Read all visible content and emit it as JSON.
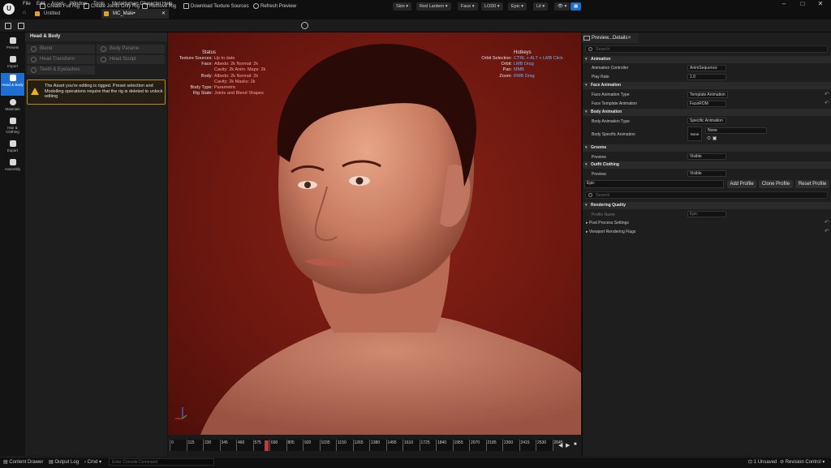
{
  "menu": [
    "File",
    "Edit",
    "Asset",
    "Window",
    "Tools",
    "MetaHuman Character",
    "Help"
  ],
  "tabs": [
    "Untitled",
    "MC_Male•"
  ],
  "toolbar": [
    "Create Full Rig",
    "Create Joints Only Rig",
    "Remove Rig",
    "Download Texture Sources",
    "Refresh Preview"
  ],
  "strip": [
    "Presets",
    "Import",
    "Head & Body",
    "Materials",
    "Hair & Clothing",
    "Export",
    "Assembly"
  ],
  "left_panel": {
    "title": "Head & Body",
    "buttons": [
      "Blend",
      "Body Parame",
      "Head Transform",
      "Head Sculpt",
      "Teeth & Eyelashes"
    ],
    "warning": "The Asset you're editing is rigged. Preset selection and Modelling operations require that the rig is deleted to unlock editing"
  },
  "viewport": {
    "bar": [
      "Skin",
      "Red Lantern",
      "Face",
      "LOD0",
      "Epic",
      "Lit"
    ],
    "status_title": "Status",
    "status": [
      {
        "label": "Texture Sources:",
        "value": "Up to date"
      },
      {
        "label": "Face:",
        "value": "Albedo: 2k Normal: 2k"
      },
      {
        "label": "",
        "value": "Cavity: 2k Anim. Maps: 2k"
      },
      {
        "label": "Body:",
        "value": "Albedo: 2k Normal: 2k"
      },
      {
        "label": "",
        "value": "Cavity: 2k Masks: 2k"
      },
      {
        "label": "Body Type:",
        "value": "Parametric"
      },
      {
        "label": "Rig State:",
        "value": "Joints and Blend Shapes"
      }
    ],
    "hotkeys_title": "Hotkeys",
    "hotkeys": [
      {
        "label": "Orbit Selection:",
        "value": "CTRL + ALT + LMB Click"
      },
      {
        "label": "Orbit:",
        "value": "LMB Drag"
      },
      {
        "label": "Pan:",
        "value": "MMB"
      },
      {
        "label": "Zoom:",
        "value": "RMB Drag"
      }
    ]
  },
  "timeline": [
    "0",
    "115",
    "230",
    "345",
    "460",
    "575",
    "690",
    "805",
    "920",
    "1035",
    "1150",
    "1265",
    "1380",
    "1495",
    "1610",
    "1725",
    "1840",
    "1955",
    "2070",
    "2185",
    "2300",
    "2415",
    "2530",
    "2645"
  ],
  "details": {
    "tab": "Preview...Details",
    "search_placeholder": "Search",
    "animation": {
      "title": "Animation",
      "controller_label": "Animation Controller",
      "controller_value": "AnimSequence",
      "rate_label": "Play Rate",
      "rate_value": "1.0"
    },
    "face_anim": {
      "title": "Face Animation",
      "type_label": "Face Animation Type",
      "type_value": "Template Animation",
      "tpl_label": "Face Template Animation",
      "tpl_value": "FaceROM"
    },
    "body_anim": {
      "title": "Body Animation",
      "type_label": "Body Animation Type",
      "type_value": "Specific Animation",
      "spec_label": "Body Specific Animation",
      "none_thumb": "None",
      "none_value": "None"
    },
    "grooms": {
      "title": "Grooms",
      "preview_label": "Preview",
      "preview_value": "Visible"
    },
    "outfit": {
      "title": "Outfit Clothing",
      "preview_label": "Preview",
      "preview_value": "Visible"
    },
    "profile": {
      "value": "Epic",
      "add": "Add Profile",
      "clone": "Clone Profile",
      "reset": "Reset Profile"
    },
    "search2_placeholder": "Search",
    "rendering": {
      "title": "Rendering Quality",
      "profile_label": "Profile Name",
      "profile_value": "Epic",
      "post": "Post Process Settings",
      "flags": "Viewport Rendering Flags"
    }
  },
  "statusbar": [
    "Content Drawer",
    "Output Log",
    "Cmd",
    "Enter Console Command",
    "1 Unsaved",
    "Revision Control"
  ]
}
